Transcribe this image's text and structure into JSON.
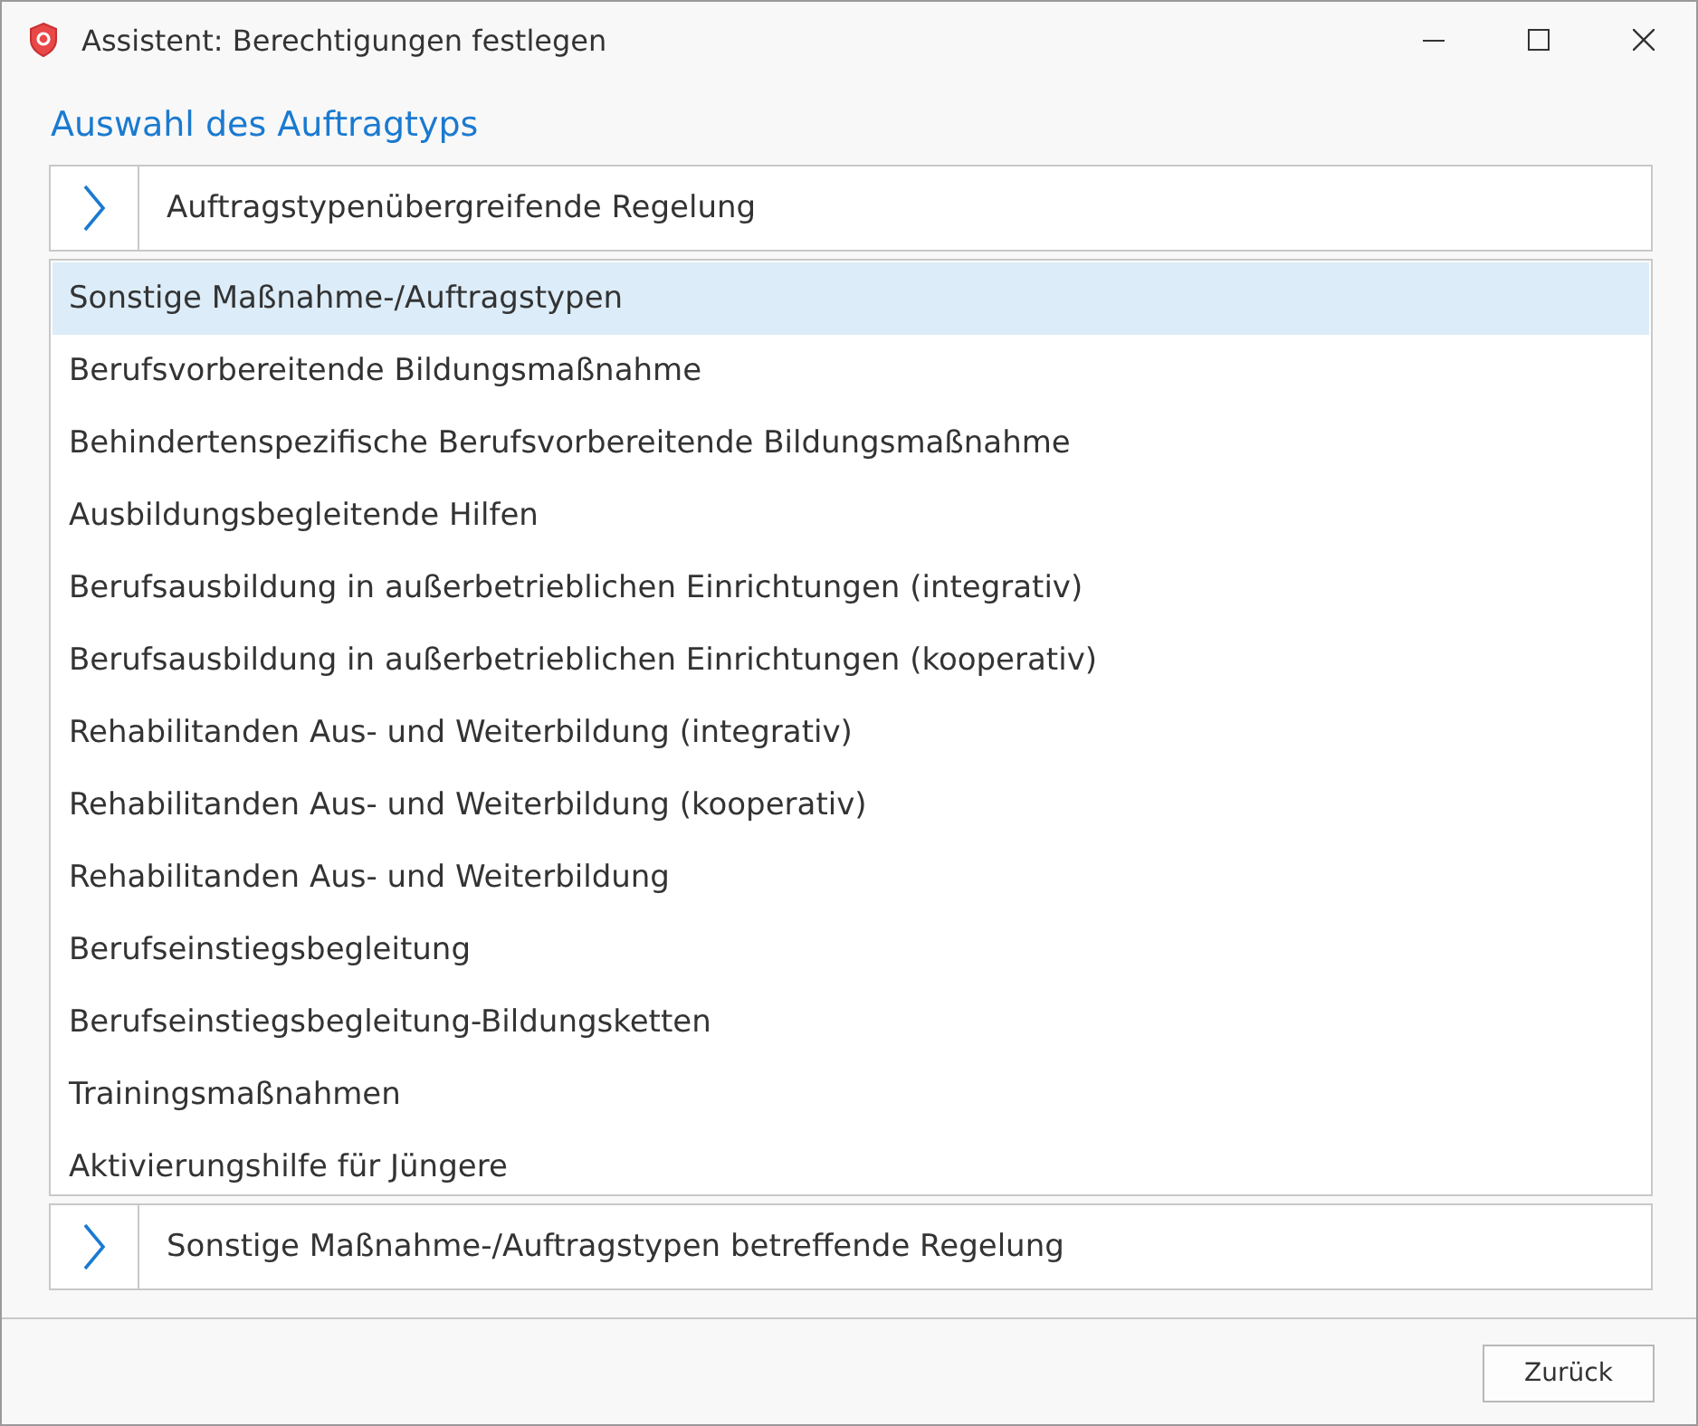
{
  "window": {
    "title": "Assistent: Berechtigungen festlegen"
  },
  "heading": "Auswahl des Auftragtyps",
  "top_expander": {
    "label": "Auftragstypenübergreifende Regelung",
    "expanded": false
  },
  "list_items": [
    {
      "label": "Sonstige Maßnahme-/Auftragstypen",
      "selected": true
    },
    {
      "label": "Berufsvorbereitende Bildungsmaßnahme",
      "selected": false
    },
    {
      "label": "Behindertenspezifische Berufsvorbereitende Bildungsmaßnahme",
      "selected": false
    },
    {
      "label": "Ausbildungsbegleitende Hilfen",
      "selected": false
    },
    {
      "label": "Berufsausbildung in außerbetrieblichen Einrichtungen (integrativ)",
      "selected": false
    },
    {
      "label": "Berufsausbildung in außerbetrieblichen Einrichtungen (kooperativ)",
      "selected": false
    },
    {
      "label": "Rehabilitanden Aus- und Weiterbildung (integrativ)",
      "selected": false
    },
    {
      "label": "Rehabilitanden Aus- und Weiterbildung (kooperativ)",
      "selected": false
    },
    {
      "label": "Rehabilitanden Aus- und Weiterbildung",
      "selected": false
    },
    {
      "label": "Berufseinstiegsbegleitung",
      "selected": false
    },
    {
      "label": "Berufseinstiegsbegleitung-Bildungsketten",
      "selected": false
    },
    {
      "label": "Trainingsmaßnahmen",
      "selected": false
    },
    {
      "label": "Aktivierungshilfe für Jüngere",
      "selected": false
    }
  ],
  "bottom_expander": {
    "label": "Sonstige Maßnahme-/Auftragstypen betreffende Regelung",
    "expanded": false
  },
  "buttons": [
    "Zurück"
  ]
}
